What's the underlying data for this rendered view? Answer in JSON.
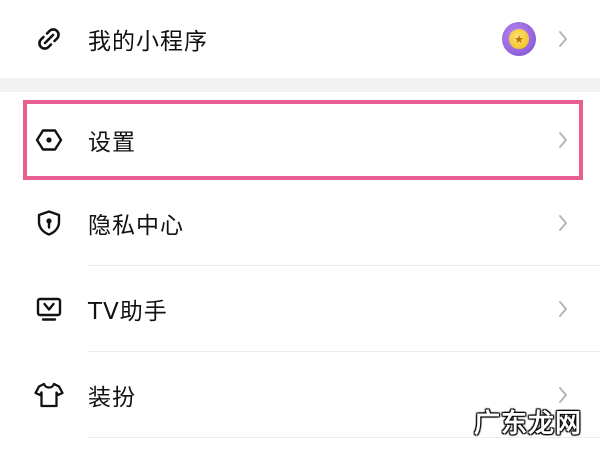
{
  "menu": {
    "items": [
      {
        "label": "我的小程序",
        "icon": "link-icon"
      },
      {
        "label": "设置",
        "icon": "hexagon-settings-icon"
      },
      {
        "label": "隐私中心",
        "icon": "shield-icon"
      },
      {
        "label": "TV助手",
        "icon": "tv-icon"
      },
      {
        "label": "装扮",
        "icon": "tshirt-icon"
      }
    ]
  },
  "watermark": "广东龙网",
  "colors": {
    "highlight": "#e85f93",
    "text": "#111111",
    "chevron": "#b5b5b5"
  }
}
